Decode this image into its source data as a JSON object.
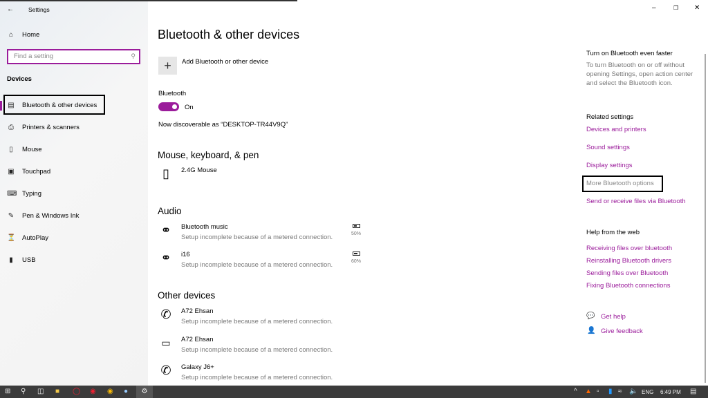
{
  "window": {
    "title": "Settings",
    "back_icon": "arrow-left-icon",
    "controls": [
      "minimize",
      "restore",
      "close"
    ]
  },
  "sidebar": {
    "home": "Home",
    "search_placeholder": "Find a setting",
    "section": "Devices",
    "items": [
      {
        "label": "Bluetooth & other devices",
        "icon": "devices-icon",
        "selected": true
      },
      {
        "label": "Printers & scanners",
        "icon": "printer-icon"
      },
      {
        "label": "Mouse",
        "icon": "mouse-icon"
      },
      {
        "label": "Touchpad",
        "icon": "touchpad-icon"
      },
      {
        "label": "Typing",
        "icon": "keyboard-icon"
      },
      {
        "label": "Pen & Windows Ink",
        "icon": "pen-icon"
      },
      {
        "label": "AutoPlay",
        "icon": "autoplay-icon"
      },
      {
        "label": "USB",
        "icon": "usb-icon"
      }
    ]
  },
  "main": {
    "title": "Bluetooth & other devices",
    "add_label": "Add Bluetooth or other device",
    "bluetooth_label": "Bluetooth",
    "toggle_state": "On",
    "discoverable": "Now discoverable as “DESKTOP-TR44V9Q”",
    "mouse_section": "Mouse, keyboard, & pen",
    "mouse_devices": [
      {
        "name": "2.4G Mouse"
      }
    ],
    "audio_section": "Audio",
    "audio_devices": [
      {
        "name": "Bluetooth music",
        "status": "Setup incomplete because of a metered connection.",
        "battery": "50%",
        "battery_level": 50
      },
      {
        "name": "i16",
        "status": "Setup incomplete because of a metered connection.",
        "battery": "60%",
        "battery_level": 60
      }
    ],
    "other_section": "Other devices",
    "other_devices": [
      {
        "name": "A72 Ehsan",
        "status": "Setup incomplete because of a metered connection.",
        "icon": "phone-icon"
      },
      {
        "name": "A72 Ehsan",
        "status": "Setup incomplete because of a metered connection.",
        "icon": "computer-icon"
      },
      {
        "name": "Galaxy J6+",
        "status": "Setup incomplete because of a metered connection.",
        "icon": "phone-icon"
      }
    ]
  },
  "right": {
    "tip_title": "Turn on Bluetooth even faster",
    "tip_text1": "To turn Bluetooth on or off without",
    "tip_text2": "opening Settings, open action center",
    "tip_text3": "and select the Bluetooth icon.",
    "related_title": "Related settings",
    "related": [
      "Devices and printers",
      "Sound settings",
      "Display settings",
      "More Bluetooth options",
      "Send or receive files via Bluetooth"
    ],
    "help_title": "Help from the web",
    "help": [
      "Receiving files over bluetooth",
      "Reinstalling Bluetooth drivers",
      "Sending files over Bluetooth",
      "Fixing Bluetooth connections"
    ],
    "get_help": "Get help",
    "feedback": "Give feedback"
  },
  "taskbar": {
    "language": "ENG",
    "time": "6:49 PM"
  },
  "colors": {
    "accent": "#9b1c9b",
    "taskbar": "#3b3b3b"
  }
}
